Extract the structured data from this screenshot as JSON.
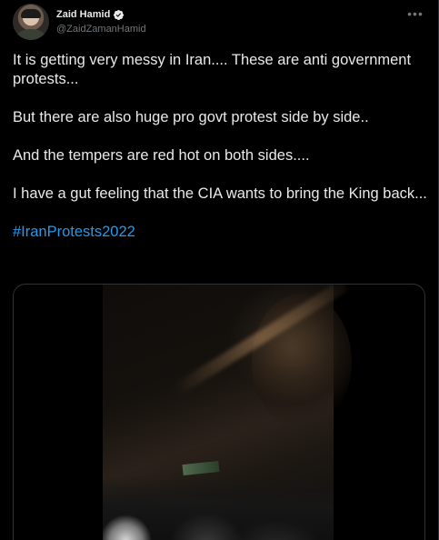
{
  "author": {
    "display_name": "Zaid Hamid",
    "handle": "@ZaidZamanHamid",
    "verified_icon": "verified-badge-icon",
    "avatar_icon": "avatar-photo"
  },
  "more_icon": "more-options-icon",
  "tweet": {
    "paragraphs": [
      "It is getting very messy in Iran.... These are anti government protests...",
      "But there are also huge pro govt protest side by side..",
      "And the tempers are red hot on both sides....",
      "I have a gut feeling that the CIA wants to bring the King back..."
    ],
    "hashtag": "#IranProtests2022"
  },
  "media": {
    "type": "video",
    "description_icon": "video-thumbnail"
  },
  "colors": {
    "background": "#000000",
    "text": "#e7e9ea",
    "secondary_text": "#71767b",
    "link": "#1d9bf0",
    "border": "#2f3336",
    "verified": "#e7e9ea"
  }
}
